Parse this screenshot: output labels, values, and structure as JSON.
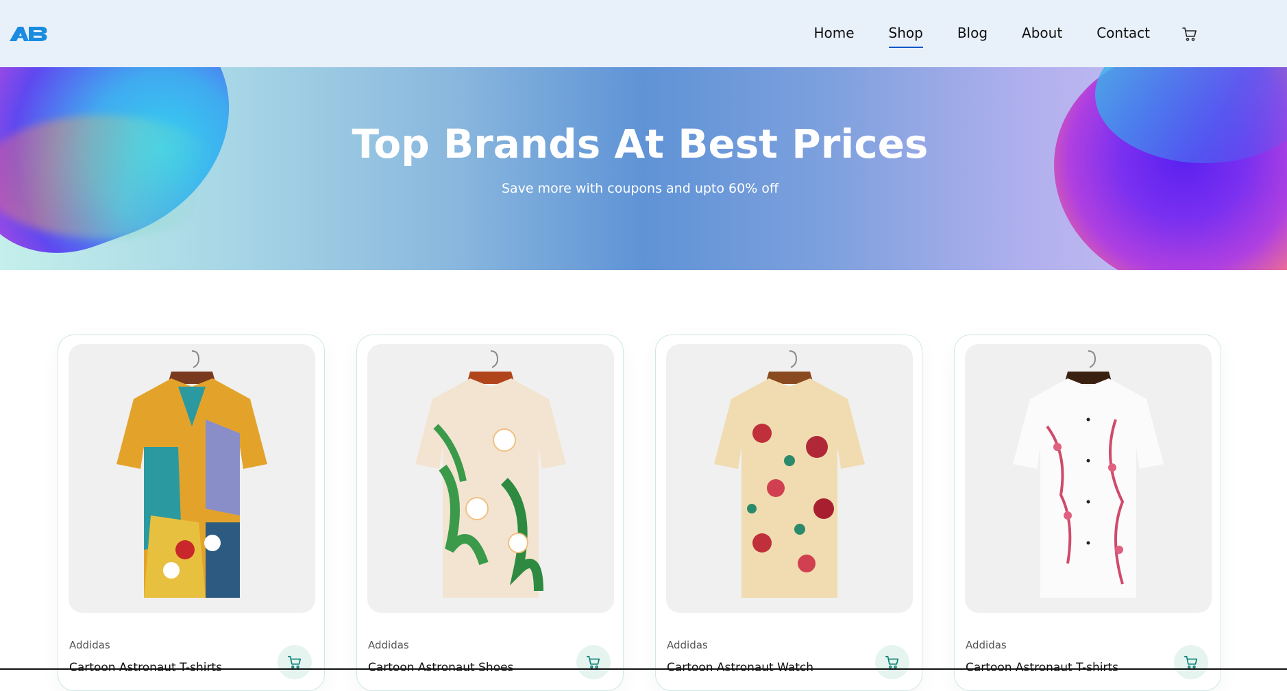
{
  "header": {
    "logo_text": "AB",
    "nav": [
      {
        "label": "Home",
        "active": false
      },
      {
        "label": "Shop",
        "active": true
      },
      {
        "label": "Blog",
        "active": false
      },
      {
        "label": "About",
        "active": false
      },
      {
        "label": "Contact",
        "active": false
      }
    ],
    "cart_icon": "cart-icon",
    "accent_color": "#0a58c8"
  },
  "hero": {
    "title": "Top Brands At Best Prices",
    "subtitle": "Save more with coupons and upto 60% off"
  },
  "products": [
    {
      "brand": "Addidas",
      "name": "Cartoon Astronaut T-shirts",
      "image": "multicolor-abstract-shirt"
    },
    {
      "brand": "Addidas",
      "name": "Cartoon Astronaut Shoes",
      "image": "green-leaf-floral-shirt"
    },
    {
      "brand": "Addidas",
      "name": "Cartoon Astronaut Watch",
      "image": "red-rose-floral-shirt"
    },
    {
      "brand": "Addidas",
      "name": "Cartoon Astronaut T-shirts",
      "image": "white-pink-blossom-shirt"
    }
  ],
  "colors": {
    "header_bg": "#e8f0fa",
    "cart_button_bg": "#e6f4f0",
    "cart_icon_color": "#088178"
  }
}
